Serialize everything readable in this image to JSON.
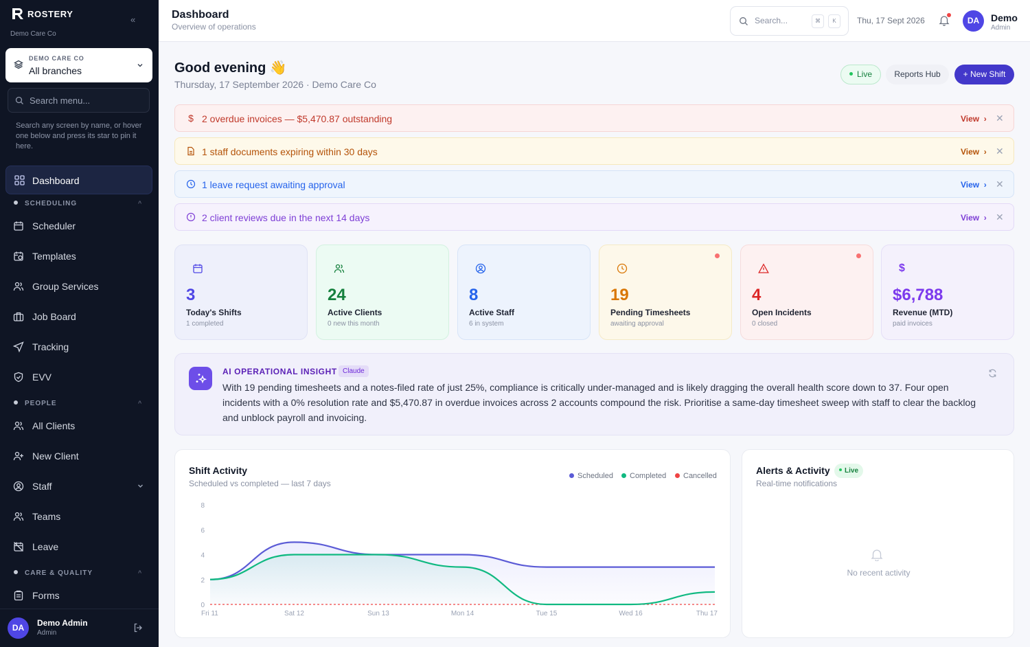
{
  "sidebar": {
    "brand": "ROSTERY",
    "org": "Demo Care Co",
    "branch": {
      "label": "DEMO CARE CO",
      "value": "All branches"
    },
    "search_placeholder": "Search menu...",
    "hint": "Search any screen by name, or hover one below and press its star to pin it here.",
    "active_item": "Dashboard",
    "sections": [
      {
        "title": "SCHEDULING",
        "items": [
          "Scheduler",
          "Templates",
          "Group Services",
          "Job Board",
          "Tracking",
          "EVV"
        ]
      },
      {
        "title": "PEOPLE",
        "items": [
          "All Clients",
          "New Client",
          "Staff",
          "Teams",
          "Leave"
        ]
      },
      {
        "title": "CARE & QUALITY",
        "items": [
          "Forms"
        ]
      }
    ],
    "user": {
      "initials": "DA",
      "name": "Demo Admin",
      "role": "Admin"
    }
  },
  "topbar": {
    "title": "Dashboard",
    "subtitle": "Overview of operations",
    "search_placeholder": "Search...",
    "kbd": [
      "⌘",
      "K"
    ],
    "date": "Thu, 17 Sept 2026",
    "user": {
      "initials": "DA",
      "name": "Demo",
      "role": "Admin"
    }
  },
  "header": {
    "greeting": "Good evening 👋",
    "subline": "Thursday, 17 September 2026 · Demo Care Co",
    "live_label": "Live",
    "reports_label": "Reports Hub",
    "new_shift_label": "+ New Shift"
  },
  "alerts": [
    {
      "icon": "$",
      "text": "2 overdue invoices — $5,470.87 outstanding",
      "action": "View",
      "color": "#c0392b"
    },
    {
      "icon": "doc",
      "text": "1 staff documents expiring within 30 days",
      "action": "View",
      "color": "#b45309"
    },
    {
      "icon": "clock",
      "text": "1 leave request awaiting approval",
      "action": "View",
      "color": "#2563eb"
    },
    {
      "icon": "info",
      "text": "2 client reviews due in the next 14 days",
      "action": "View",
      "color": "#7e3fd6"
    }
  ],
  "stats": [
    {
      "value": "3",
      "label": "Today's Shifts",
      "sub": "1 completed",
      "icon": "calendar-icon",
      "color": "#4f46e5"
    },
    {
      "value": "24",
      "label": "Active Clients",
      "sub": "0 new this month",
      "icon": "users-icon",
      "color": "#15803d"
    },
    {
      "value": "8",
      "label": "Active Staff",
      "sub": "6 in system",
      "icon": "user-circle-icon",
      "color": "#2563eb"
    },
    {
      "value": "19",
      "label": "Pending Timesheets",
      "sub": "awaiting approval",
      "icon": "clock-icon",
      "color": "#d97706"
    },
    {
      "value": "4",
      "label": "Open Incidents",
      "sub": "0 closed",
      "icon": "warning-icon",
      "color": "#dc2626"
    },
    {
      "value": "$6,788",
      "label": "Revenue (MTD)",
      "sub": "paid invoices",
      "icon": "dollar-icon",
      "color": "#7c3aed"
    }
  ],
  "insight": {
    "title": "AI OPERATIONAL INSIGHT",
    "tag": "Claude",
    "body": "With 19 pending timesheets and a notes-filed rate of just 25%, compliance is critically under-managed and is likely dragging the overall health score down to 37. Four open incidents with a 0% resolution rate and $5,470.87 in overdue invoices across 2 accounts compound the risk. Prioritise a same-day timesheet sweep with staff to clear the backlog and unblock payroll and invoicing."
  },
  "shift_chart": {
    "title": "Shift Activity",
    "subtitle": "Scheduled vs completed — last 7 days",
    "legend": [
      "Scheduled",
      "Completed",
      "Cancelled"
    ]
  },
  "chart_data": {
    "type": "area",
    "categories": [
      "Fri 11",
      "Sat 12",
      "Sun 13",
      "Mon 14",
      "Tue 15",
      "Wed 16",
      "Thu 17"
    ],
    "y_ticks": [
      "0",
      "2",
      "4",
      "6",
      "8"
    ],
    "ylim": [
      0,
      8
    ],
    "series": [
      {
        "name": "Scheduled",
        "values": [
          2,
          5,
          4,
          4,
          3,
          3,
          3
        ],
        "color": "#5b5bd6"
      },
      {
        "name": "Completed",
        "values": [
          2,
          4,
          4,
          3,
          0,
          0,
          1
        ],
        "color": "#10b981"
      },
      {
        "name": "Cancelled",
        "values": [
          0,
          0,
          0,
          0,
          0,
          0,
          0
        ],
        "color": "#ef4444"
      }
    ],
    "grid": false,
    "legend_position": "top-right"
  },
  "activity": {
    "title": "Alerts & Activity",
    "live_label": "Live",
    "subtitle": "Real-time notifications",
    "empty": "No recent activity"
  }
}
